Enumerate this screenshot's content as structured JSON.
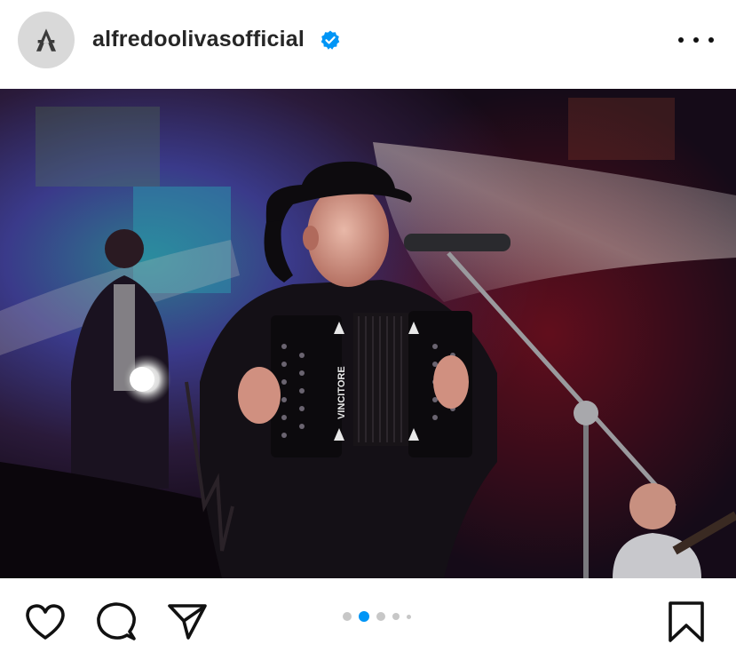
{
  "post": {
    "username": "alfredoolivasofficial",
    "verified": true,
    "avatar_monogram": "A",
    "image_alt": "Alfredo Olivas performing on stage with accordion",
    "accordion_brand": "VINCITORE",
    "carousel": {
      "count": 5,
      "active_index": 1
    }
  },
  "icons": {
    "avatar": "logo-monogram",
    "verified": "verified-badge-icon",
    "more": "more-options-icon",
    "like": "heart-icon",
    "comment": "comment-icon",
    "share": "send-icon",
    "save": "bookmark-icon"
  },
  "colors": {
    "verified_blue": "#0095f6",
    "active_dot": "#0095f6",
    "inactive_dot": "#c7c7c7",
    "text": "#262626"
  }
}
